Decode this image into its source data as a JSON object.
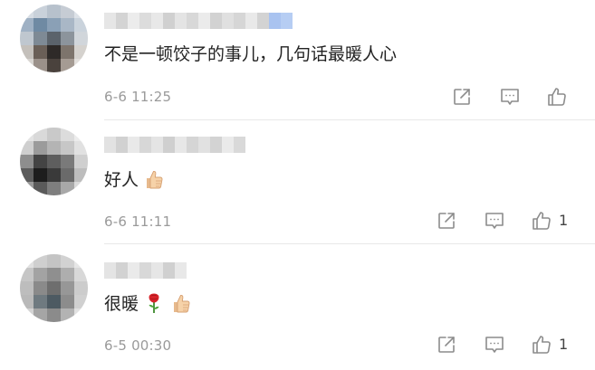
{
  "comments": [
    {
      "text": "不是一顿饺子的事儿，几句话最暖人心",
      "emojis": [],
      "time": "6-6 11:25",
      "likes": ""
    },
    {
      "text": "好人",
      "emojis": [
        "thumbs-up"
      ],
      "time": "6-6 11:11",
      "likes": "1"
    },
    {
      "text": "很暖",
      "emojis": [
        "rose",
        "thumbs-up"
      ],
      "time": "6-5 00:30",
      "likes": "1"
    }
  ],
  "icons": {
    "share": "share-icon",
    "reply": "reply-icon",
    "like": "thumbs-up-icon"
  },
  "colors": {
    "text": "#222222",
    "meta": "#9a9a9a",
    "icon": "#8c8c8c",
    "divider": "#e8e8e8"
  }
}
